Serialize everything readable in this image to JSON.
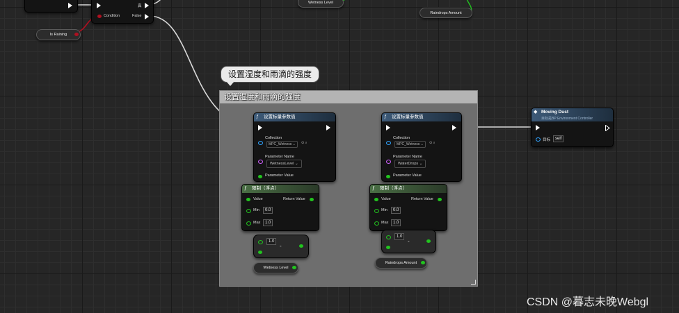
{
  "colors": {
    "exec_wire": "#ffffff",
    "float_wire": "#22c41f",
    "bool_wire": "#b01020"
  },
  "comment": {
    "bubble_text": "设置湿度和雨滴的强度",
    "title": "设置湿度和雨滴的强度"
  },
  "branch": {
    "condition_label": "Condition",
    "true_label": "真",
    "false_label": "False"
  },
  "is_raining": {
    "label": "Is Raining"
  },
  "top_getters": {
    "wetness": "Wetness Level",
    "raindrops": "Raindrops Amount"
  },
  "set_param_1": {
    "title": "设置标量参数值",
    "collection_label": "Collection",
    "collection_value": "MPC_Wetness",
    "param_name_label": "Parameter Name",
    "param_name_value": "WetnessLevel",
    "param_value_label": "Parameter Value",
    "icon": "function-icon"
  },
  "set_param_2": {
    "title": "设置标量参数值",
    "collection_label": "Collection",
    "collection_value": "MPC_Wetness",
    "param_name_label": "Parameter Name",
    "param_name_value": "WaterDrops",
    "param_value_label": "Parameter Value",
    "icon": "function-icon"
  },
  "clamp_1": {
    "title": "限制（浮点）",
    "value_label": "Value",
    "return_label": "Return Value",
    "min_label": "Min",
    "min_value": "0.0",
    "max_label": "Max",
    "max_value": "1.0"
  },
  "clamp_2": {
    "title": "限制（浮点）",
    "value_label": "Value",
    "return_label": "Return Value",
    "min_label": "Min",
    "min_value": "0.0",
    "max_label": "Max",
    "max_value": "1.0"
  },
  "subtract_1": {
    "value": "1.0",
    "op": "-"
  },
  "subtract_2": {
    "value": "1.0",
    "op": "-"
  },
  "bottom_getters": {
    "wetness": "Wetness Level",
    "raindrops": "Raindrops Amount"
  },
  "moving_dust": {
    "title": "Moving Dust",
    "subtitle": "目标是BP Environment Controller",
    "target_label": "目标",
    "target_value": "self"
  },
  "watermark": "CSDN @暮志未晚Webgl"
}
